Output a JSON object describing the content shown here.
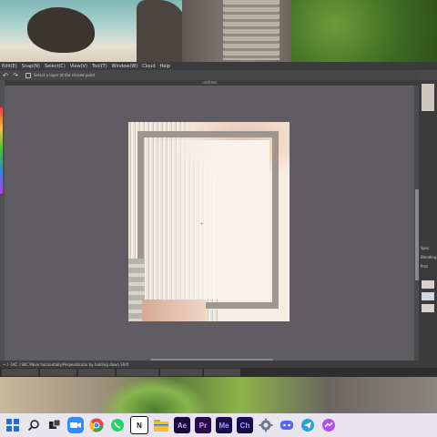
{
  "app": {
    "menu": [
      "Edit(E)",
      "Snap(N)",
      "Select(C)",
      "View(V)",
      "Tool(T)",
      "Window(W)",
      "Cloud",
      "Help"
    ],
    "toolbar": {
      "checkbox_label": "Select a layer at the clicked point"
    },
    "doc_title": "untitled",
    "status_text": "~ / -1KC / SKC Move horizontally/Perpendicular by holding down Shift",
    "right_panel_labels": [
      "Spec",
      "Blending",
      "Prot"
    ],
    "bottom_tabs": [
      "",
      "",
      "",
      "",
      "",
      ""
    ]
  },
  "colors": {
    "canvas_bg": "#5f5c62",
    "app_bg": "#4a4a4a",
    "taskbar_bg": "#e9e5ee",
    "artboard_bg": "#f8ede4",
    "frame": "#9e968f"
  },
  "taskbar": {
    "items": [
      {
        "name": "windows-start",
        "label": "",
        "color": "#1e6fd9"
      },
      {
        "name": "search",
        "label": "",
        "color": "#e9e5ee"
      },
      {
        "name": "task-view",
        "label": "",
        "color": "#e9e5ee"
      },
      {
        "name": "zoom",
        "label": "",
        "color": "#2d8cff"
      },
      {
        "name": "chrome",
        "label": "",
        "color": "#e8453c"
      },
      {
        "name": "whatsapp",
        "label": "",
        "color": "#25d366"
      },
      {
        "name": "notion",
        "label": "N",
        "color": "#111111"
      },
      {
        "name": "file-explorer",
        "label": "",
        "color": "#f0c030"
      },
      {
        "name": "after-effects",
        "label": "Ae",
        "color": "#1a0b3b"
      },
      {
        "name": "premiere-pro",
        "label": "Pr",
        "color": "#2a0a4b"
      },
      {
        "name": "media-encoder",
        "label": "Me",
        "color": "#1a0b4b"
      },
      {
        "name": "character-animator",
        "label": "Ch",
        "color": "#1a0b4b"
      },
      {
        "name": "settings",
        "label": "",
        "color": "#6c7a89"
      },
      {
        "name": "discord",
        "label": "",
        "color": "#5865f2"
      },
      {
        "name": "telegram",
        "label": "",
        "color": "#2aa1da"
      },
      {
        "name": "messenger",
        "label": "",
        "color": "#b44ef0"
      }
    ]
  }
}
